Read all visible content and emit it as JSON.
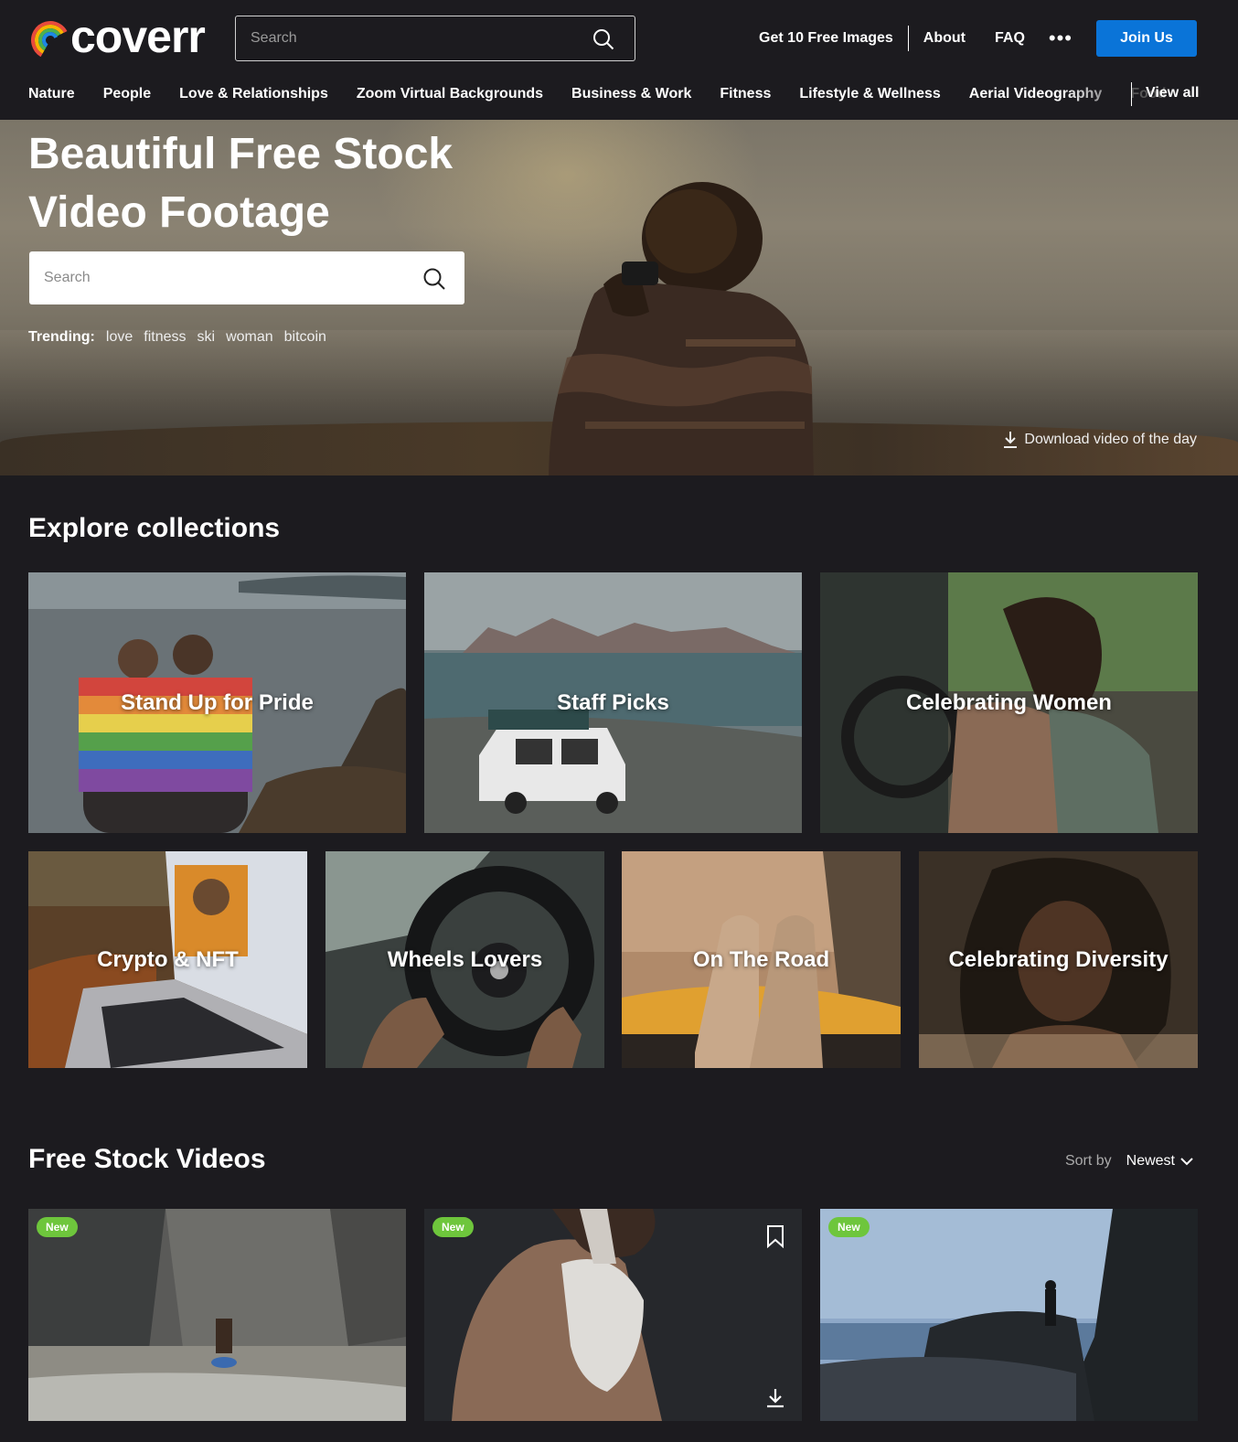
{
  "header": {
    "logo_text": "coverr",
    "search_placeholder": "Search",
    "links": {
      "free_images": "Get 10 Free Images",
      "about": "About",
      "faq": "FAQ",
      "more": "•••",
      "join": "Join Us"
    },
    "brand_color": "#0a74d8"
  },
  "categories": [
    "Nature",
    "People",
    "Love & Relationships",
    "Zoom Virtual Backgrounds",
    "Business & Work",
    "Fitness",
    "Lifestyle & Wellness",
    "Aerial Videography",
    "Food"
  ],
  "view_all": "View all",
  "hero": {
    "title_line1": "Beautiful Free Stock",
    "title_line2": "Video Footage",
    "search_placeholder": "Search",
    "trending_label": "Trending:",
    "trending": [
      "love",
      "fitness",
      "ski",
      "woman",
      "bitcoin"
    ],
    "download_day": "Download video of the day"
  },
  "collections": {
    "title": "Explore collections",
    "items": [
      "Stand Up for Pride",
      "Staff Picks",
      "Celebrating Women",
      "Crypto & NFT",
      "Wheels Lovers",
      "On The Road",
      "Celebrating Diversity"
    ]
  },
  "videos": {
    "title": "Free Stock Videos",
    "sort_label": "Sort by",
    "sort_value": "Newest",
    "badge": "New",
    "badge_color": "#6ec63c"
  }
}
